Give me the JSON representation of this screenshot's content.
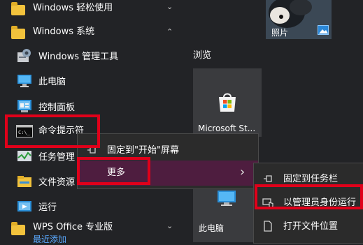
{
  "start_list": {
    "items": [
      {
        "label": "Windows 轻松使用",
        "icon": "folder-icon",
        "chevron": "⌄"
      },
      {
        "label": "Windows 系统",
        "icon": "folder-icon",
        "chevron": "⌃"
      },
      {
        "label": "Windows 管理工具",
        "icon": "admin-tools-icon"
      },
      {
        "label": "此电脑",
        "icon": "this-pc-icon"
      },
      {
        "label": "控制面板",
        "icon": "control-panel-icon"
      },
      {
        "label": "命令提示符",
        "icon": "cmd-icon"
      },
      {
        "label": "任务管理",
        "icon": "task-manager-icon"
      },
      {
        "label": "文件资源",
        "icon": "file-explorer-icon"
      },
      {
        "label": "运行",
        "icon": "run-icon"
      },
      {
        "label": "WPS Office 专业版",
        "icon": "folder-icon",
        "chevron": "⌄"
      }
    ],
    "recent_hint": "最近添加"
  },
  "tiles": {
    "photos_label": "照片",
    "browse_header": "浏览",
    "store_label": "Microsoft St...",
    "this_pc_label": "此电脑"
  },
  "context_menu": {
    "pin_start": "固定到\"开始\"屏幕",
    "more": "更多",
    "more_arrow": "›"
  },
  "sub_menu": {
    "pin_taskbar": "固定到任务栏",
    "run_as_admin": "以管理员身份运行",
    "open_location": "打开文件位置"
  },
  "colors": {
    "highlight_red": "#e0001a",
    "more_hover": "#4e1d3f",
    "folder_yellow": "#f2c23c"
  }
}
